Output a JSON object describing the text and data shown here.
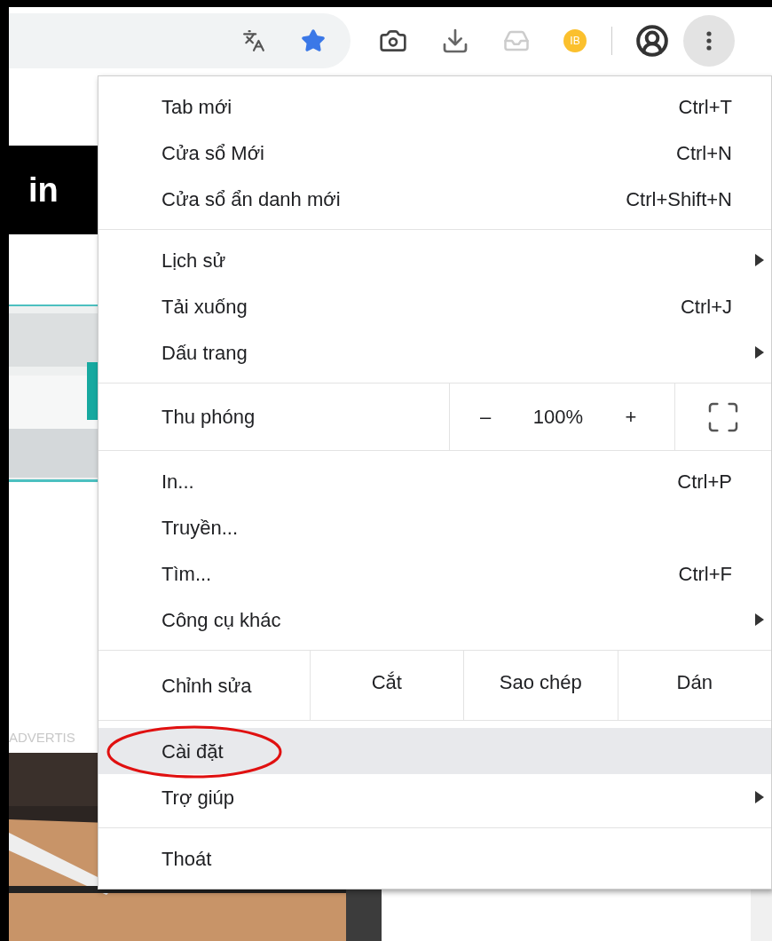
{
  "toolbar": {
    "extension_badge": "IB"
  },
  "page": {
    "linkedin_logo": "in",
    "ad_label": "ADVERTIS"
  },
  "menu": {
    "sections": [
      {
        "kind": "items",
        "items": [
          {
            "label": "Tab mới",
            "shortcut": "Ctrl+T",
            "submenu": false,
            "selected": false
          },
          {
            "label": "Cửa sổ Mới",
            "shortcut": "Ctrl+N",
            "submenu": false,
            "selected": false
          },
          {
            "label": "Cửa sổ ẩn danh mới",
            "shortcut": "Ctrl+Shift+N",
            "submenu": false,
            "selected": false
          }
        ]
      },
      {
        "kind": "items",
        "items": [
          {
            "label": "Lịch sử",
            "submenu": true,
            "selected": false
          },
          {
            "label": "Tải xuống",
            "shortcut": "Ctrl+J",
            "submenu": false,
            "selected": false
          },
          {
            "label": "Dấu trang",
            "submenu": true,
            "selected": false
          }
        ]
      },
      {
        "kind": "zoom",
        "label": "Thu phóng",
        "minus": "–",
        "value": "100%",
        "plus": "+"
      },
      {
        "kind": "items",
        "items": [
          {
            "label": "In...",
            "shortcut": "Ctrl+P",
            "submenu": false,
            "selected": false
          },
          {
            "label": "Truyền...",
            "submenu": false,
            "selected": false
          },
          {
            "label": "Tìm...",
            "shortcut": "Ctrl+F",
            "submenu": false,
            "selected": false
          },
          {
            "label": "Công cụ khác",
            "submenu": true,
            "selected": false
          }
        ]
      },
      {
        "kind": "edit",
        "label": "Chỉnh sửa",
        "buttons": [
          "Cắt",
          "Sao chép",
          "Dán"
        ]
      },
      {
        "kind": "items",
        "items": [
          {
            "label": "Cài đặt",
            "submenu": false,
            "selected": true
          },
          {
            "label": "Trợ giúp",
            "submenu": true,
            "selected": false
          }
        ]
      },
      {
        "kind": "items",
        "items": [
          {
            "label": "Thoát",
            "submenu": false,
            "selected": false
          }
        ]
      }
    ]
  }
}
